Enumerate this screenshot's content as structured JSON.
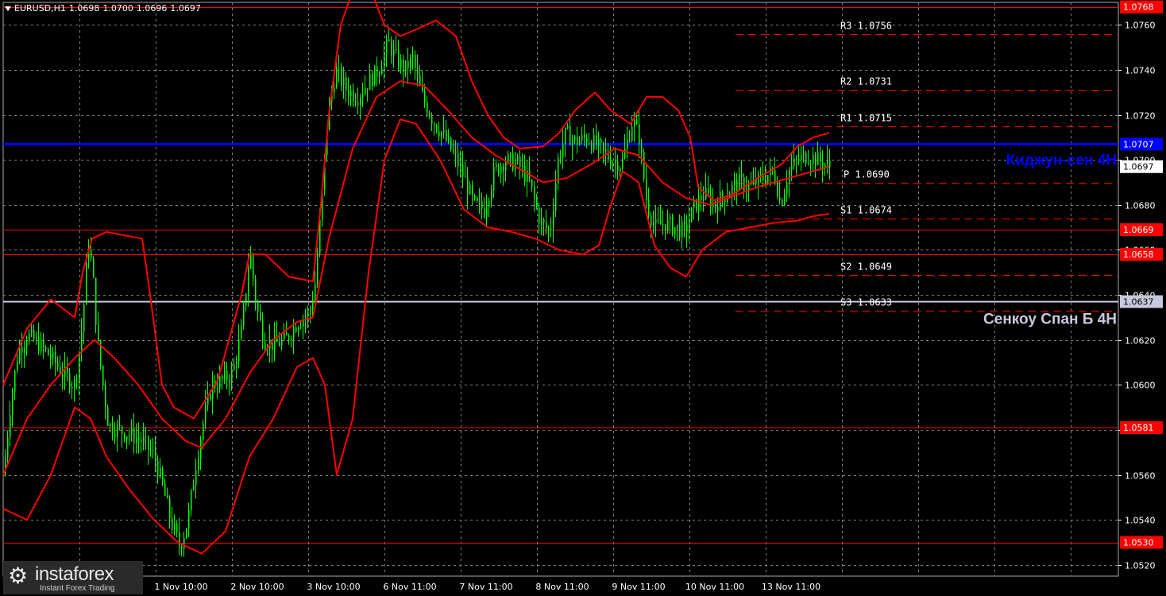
{
  "header": {
    "symbol": "EURUSD,H1",
    "open": "1.0698",
    "high": "1.0700",
    "low": "1.0696",
    "close": "1.0697"
  },
  "logo": {
    "brand": "instaforex",
    "tagline": "Instant Forex Trading"
  },
  "colors": {
    "background": "#000000",
    "candles": "#00ff00",
    "bollinger": "#ff0000",
    "kijun": "#0000ff",
    "senkou_b": "#c8c8dc",
    "levels": "#ff0000",
    "pivots": "#ff0000",
    "grid": "#808080"
  },
  "chart_data": {
    "type": "candlestick",
    "title": "",
    "ylim": [
      1.0515,
      1.077
    ],
    "price_ticks": [
      "1.0520",
      "1.0540",
      "1.0560",
      "1.0580",
      "1.0600",
      "1.0620",
      "1.0640",
      "1.0660",
      "1.0680",
      "1.0700",
      "1.0720",
      "1.0740",
      "1.0760"
    ],
    "x_labels": [
      "1 Nov 10:00",
      "2 Nov 10:00",
      "3 Nov 10:00",
      "6 Nov 11:00",
      "7 Nov 11:00",
      "8 Nov 11:00",
      "9 Nov 11:00",
      "10 Nov 11:00",
      "13 Nov 11:00"
    ],
    "current_price": "1.0697",
    "support_resistance_levels": [
      "1.0768",
      "1.0669",
      "1.0658",
      "1.0581",
      "1.0530"
    ],
    "kijun": {
      "label": "Киджун-сен 4H",
      "value": "1.0707"
    },
    "senkou_span_b": {
      "label": "Сенкоу Спан Б 4H",
      "value": "1.0637"
    },
    "pivots": [
      {
        "name": "R3",
        "value": "1.0756"
      },
      {
        "name": "R2",
        "value": "1.0731"
      },
      {
        "name": "R1",
        "value": "1.0715"
      },
      {
        "name": "P",
        "value": "1.0690"
      },
      {
        "name": "S1",
        "value": "1.0674"
      },
      {
        "name": "S2",
        "value": "1.0649"
      },
      {
        "name": "S3",
        "value": "1.0633"
      }
    ],
    "price_path": [
      [
        0,
        1.056
      ],
      [
        8,
        1.059
      ],
      [
        18,
        1.0615
      ],
      [
        30,
        1.0622
      ],
      [
        45,
        1.0618
      ],
      [
        60,
        1.0612
      ],
      [
        75,
        1.0605
      ],
      [
        90,
        1.06
      ],
      [
        100,
        1.063
      ],
      [
        106,
        1.0665
      ],
      [
        112,
        1.065
      ],
      [
        118,
        1.062
      ],
      [
        125,
        1.06
      ],
      [
        132,
        1.0582
      ],
      [
        145,
        1.058
      ],
      [
        160,
        1.0578
      ],
      [
        175,
        1.0575
      ],
      [
        190,
        1.0568
      ],
      [
        200,
        1.0555
      ],
      [
        210,
        1.054
      ],
      [
        222,
        1.0528
      ],
      [
        232,
        1.054
      ],
      [
        242,
        1.0565
      ],
      [
        252,
        1.0585
      ],
      [
        262,
        1.06
      ],
      [
        275,
        1.0602
      ],
      [
        288,
        1.0605
      ],
      [
        300,
        1.0625
      ],
      [
        310,
        1.066
      ],
      [
        318,
        1.0635
      ],
      [
        328,
        1.062
      ],
      [
        340,
        1.0618
      ],
      [
        355,
        1.062
      ],
      [
        370,
        1.0628
      ],
      [
        385,
        1.0632
      ],
      [
        392,
        1.0645
      ],
      [
        400,
        1.068
      ],
      [
        408,
        1.072
      ],
      [
        418,
        1.074
      ],
      [
        430,
        1.0732
      ],
      [
        445,
        1.0728
      ],
      [
        460,
        1.0735
      ],
      [
        472,
        1.074
      ],
      [
        484,
        1.0752
      ],
      [
        494,
        1.0745
      ],
      [
        505,
        1.074
      ],
      [
        515,
        1.0745
      ],
      [
        525,
        1.073
      ],
      [
        540,
        1.0718
      ],
      [
        555,
        1.071
      ],
      [
        570,
        1.07
      ],
      [
        582,
        1.069
      ],
      [
        592,
        1.068
      ],
      [
        605,
        1.0678
      ],
      [
        618,
        1.0695
      ],
      [
        632,
        1.07
      ],
      [
        648,
        1.0698
      ],
      [
        662,
        1.069
      ],
      [
        676,
        1.0672
      ],
      [
        688,
        1.0668
      ],
      [
        698,
        1.07
      ],
      [
        708,
        1.0712
      ],
      [
        720,
        1.0708
      ],
      [
        735,
        1.071
      ],
      [
        750,
        1.0705
      ],
      [
        765,
        1.07
      ],
      [
        778,
        1.0698
      ],
      [
        792,
        1.0718
      ],
      [
        800,
        1.071
      ],
      [
        810,
        1.068
      ],
      [
        820,
        1.067
      ],
      [
        832,
        1.0672
      ],
      [
        845,
        1.067
      ],
      [
        858,
        1.0668
      ],
      [
        870,
        1.068
      ],
      [
        882,
        1.0685
      ],
      [
        895,
        1.068
      ],
      [
        910,
        1.0685
      ],
      [
        925,
        1.069
      ],
      [
        940,
        1.0688
      ],
      [
        955,
        1.0692
      ],
      [
        970,
        1.0695
      ],
      [
        978,
        1.068
      ],
      [
        988,
        1.0695
      ],
      [
        1000,
        1.07
      ],
      [
        1012,
        1.0702
      ],
      [
        1025,
        1.07
      ],
      [
        1040,
        1.0697
      ]
    ],
    "bollinger": {
      "upper": [
        [
          0,
          1.06
        ],
        [
          30,
          1.0625
        ],
        [
          60,
          1.0638
        ],
        [
          90,
          1.063
        ],
        [
          100,
          1.065
        ],
        [
          112,
          1.0665
        ],
        [
          130,
          1.0668
        ],
        [
          175,
          1.0665
        ],
        [
          185,
          1.064
        ],
        [
          200,
          1.06
        ],
        [
          215,
          1.059
        ],
        [
          240,
          1.0585
        ],
        [
          270,
          1.0602
        ],
        [
          300,
          1.064
        ],
        [
          310,
          1.0658
        ],
        [
          330,
          1.0658
        ],
        [
          360,
          1.0648
        ],
        [
          390,
          1.0646
        ],
        [
          400,
          1.068
        ],
        [
          410,
          1.072
        ],
        [
          425,
          1.076
        ],
        [
          440,
          1.0775
        ],
        [
          460,
          1.0778
        ],
        [
          480,
          1.076
        ],
        [
          500,
          1.0755
        ],
        [
          520,
          1.0758
        ],
        [
          545,
          1.0762
        ],
        [
          570,
          1.0755
        ],
        [
          590,
          1.0735
        ],
        [
          610,
          1.072
        ],
        [
          630,
          1.071
        ],
        [
          650,
          1.0705
        ],
        [
          680,
          1.0706
        ],
        [
          700,
          1.0712
        ],
        [
          720,
          1.0722
        ],
        [
          745,
          1.073
        ],
        [
          765,
          1.0722
        ],
        [
          790,
          1.0716
        ],
        [
          810,
          1.0728
        ],
        [
          830,
          1.0728
        ],
        [
          850,
          1.0722
        ],
        [
          865,
          1.071
        ],
        [
          875,
          1.0688
        ],
        [
          895,
          1.0682
        ],
        [
          920,
          1.0685
        ],
        [
          950,
          1.0692
        ],
        [
          980,
          1.0698
        ],
        [
          1000,
          1.0706
        ],
        [
          1020,
          1.071
        ],
        [
          1040,
          1.0712
        ]
      ],
      "middle": [
        [
          0,
          1.056
        ],
        [
          30,
          1.0585
        ],
        [
          60,
          1.06
        ],
        [
          90,
          1.0612
        ],
        [
          115,
          1.062
        ],
        [
          140,
          1.0612
        ],
        [
          170,
          1.06
        ],
        [
          200,
          1.0585
        ],
        [
          230,
          1.0575
        ],
        [
          250,
          1.0572
        ],
        [
          280,
          1.0585
        ],
        [
          310,
          1.0605
        ],
        [
          340,
          1.062
        ],
        [
          370,
          1.0628
        ],
        [
          390,
          1.063
        ],
        [
          410,
          1.0665
        ],
        [
          440,
          1.0705
        ],
        [
          470,
          1.0728
        ],
        [
          500,
          1.0735
        ],
        [
          530,
          1.0733
        ],
        [
          560,
          1.0722
        ],
        [
          590,
          1.071
        ],
        [
          620,
          1.0702
        ],
        [
          650,
          1.0696
        ],
        [
          680,
          1.069
        ],
        [
          710,
          1.0692
        ],
        [
          740,
          1.0698
        ],
        [
          770,
          1.0705
        ],
        [
          800,
          1.0702
        ],
        [
          830,
          1.069
        ],
        [
          860,
          1.0683
        ],
        [
          890,
          1.068
        ],
        [
          920,
          1.0684
        ],
        [
          950,
          1.0688
        ],
        [
          980,
          1.0691
        ],
        [
          1010,
          1.0694
        ],
        [
          1040,
          1.0697
        ]
      ],
      "lower": [
        [
          0,
          1.0545
        ],
        [
          30,
          1.054
        ],
        [
          60,
          1.056
        ],
        [
          90,
          1.059
        ],
        [
          110,
          1.0585
        ],
        [
          130,
          1.0568
        ],
        [
          160,
          1.0553
        ],
        [
          190,
          1.054
        ],
        [
          220,
          1.053
        ],
        [
          250,
          1.0525
        ],
        [
          280,
          1.0535
        ],
        [
          310,
          1.0568
        ],
        [
          340,
          1.0585
        ],
        [
          370,
          1.0608
        ],
        [
          390,
          1.0612
        ],
        [
          405,
          1.06
        ],
        [
          420,
          1.056
        ],
        [
          440,
          1.0585
        ],
        [
          460,
          1.065
        ],
        [
          480,
          1.07
        ],
        [
          500,
          1.0718
        ],
        [
          520,
          1.0716
        ],
        [
          550,
          1.07
        ],
        [
          580,
          1.0678
        ],
        [
          610,
          1.067
        ],
        [
          640,
          1.0668
        ],
        [
          670,
          1.0665
        ],
        [
          700,
          1.066
        ],
        [
          730,
          1.0658
        ],
        [
          750,
          1.0662
        ],
        [
          765,
          1.068
        ],
        [
          780,
          1.0695
        ],
        [
          800,
          1.069
        ],
        [
          820,
          1.0662
        ],
        [
          840,
          1.0652
        ],
        [
          860,
          1.0648
        ],
        [
          880,
          1.066
        ],
        [
          910,
          1.0668
        ],
        [
          940,
          1.067
        ],
        [
          970,
          1.0672
        ],
        [
          1000,
          1.0673
        ],
        [
          1020,
          1.0675
        ],
        [
          1040,
          1.0676
        ]
      ]
    }
  }
}
